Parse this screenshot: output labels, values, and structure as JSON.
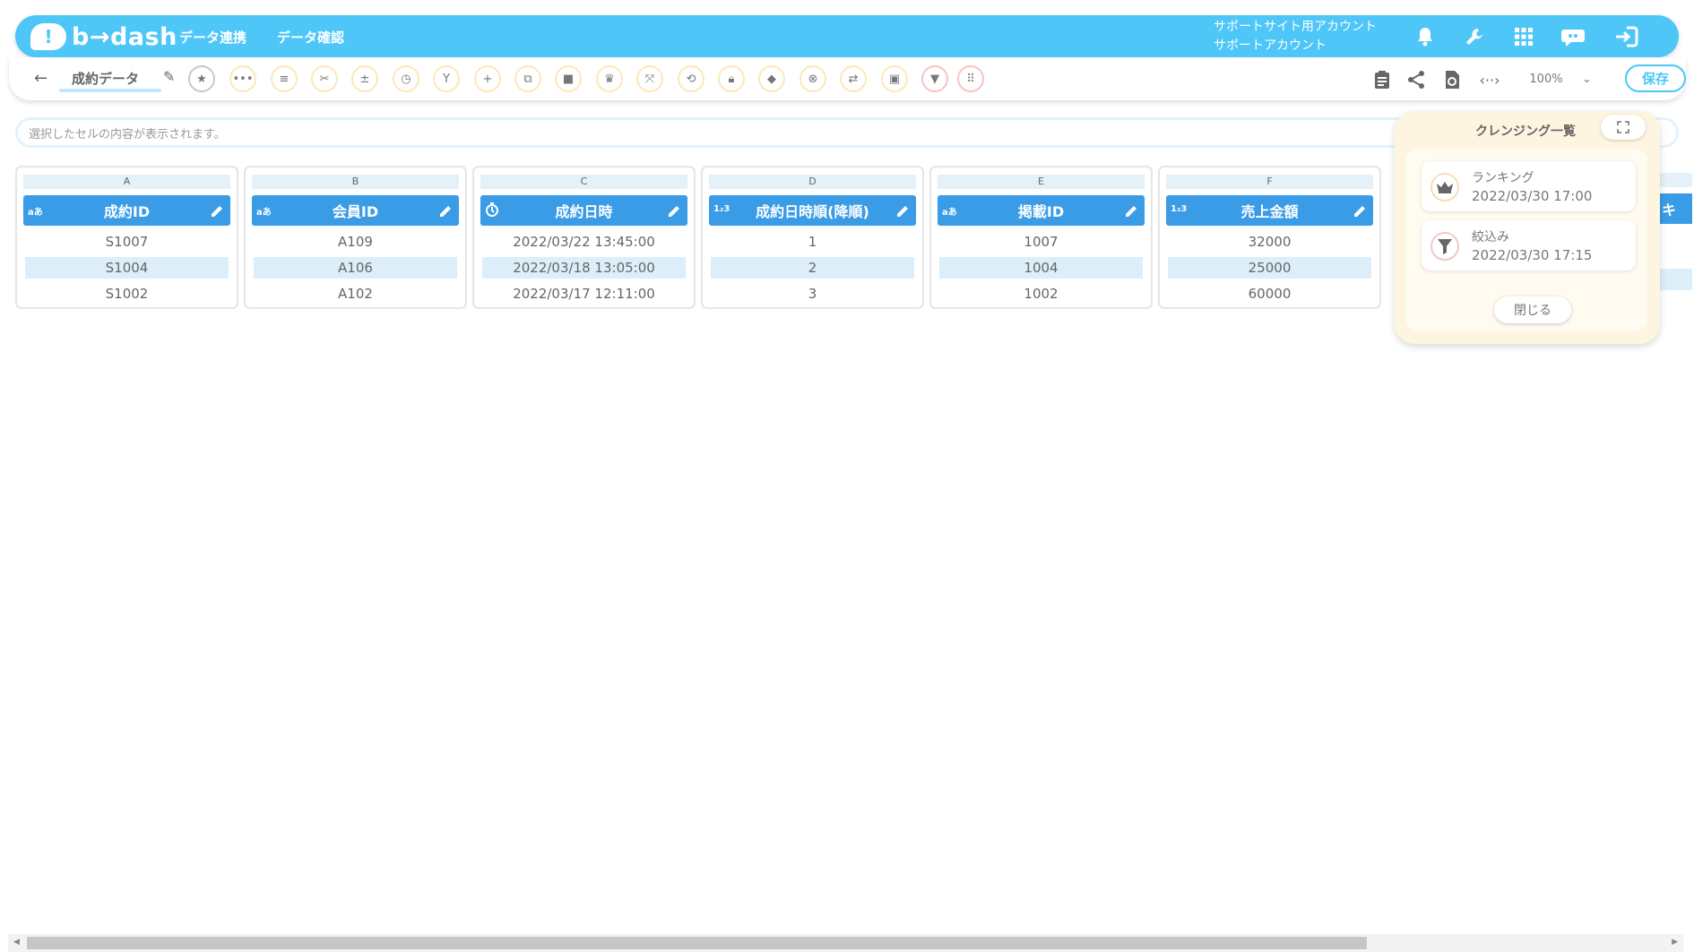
{
  "header": {
    "logo_text": "b→dash",
    "nav": [
      "データ連携",
      "データ確認"
    ],
    "account_line1": "サポートサイト用アカウント",
    "account_line2": "サポートアカウント"
  },
  "toolbar": {
    "sheet_name": "成約データ",
    "zoom": "100%",
    "save_label": "保存"
  },
  "cell_bar": {
    "placeholder": "選択したセルの内容が表示されます。"
  },
  "columns": [
    {
      "letter": "A",
      "type": "aあ",
      "name": "成約ID",
      "cells": [
        "S1007",
        "S1004",
        "S1002"
      ]
    },
    {
      "letter": "B",
      "type": "aあ",
      "name": "会員ID",
      "cells": [
        "A109",
        "A106",
        "A102"
      ]
    },
    {
      "letter": "C",
      "type": "clock",
      "name": "成約日時",
      "cells": [
        "2022/03/22 13:45:00",
        "2022/03/18 13:05:00",
        "2022/03/17 12:11:00"
      ]
    },
    {
      "letter": "D",
      "type": "1₂3",
      "name": "成約日時順(降順)",
      "cells": [
        "1",
        "2",
        "3"
      ]
    },
    {
      "letter": "E",
      "type": "aあ",
      "name": "掲載ID",
      "cells": [
        "1007",
        "1004",
        "1002"
      ]
    },
    {
      "letter": "F",
      "type": "1₂3",
      "name": "売上金額",
      "cells": [
        "32000",
        "25000",
        "60000"
      ]
    }
  ],
  "partial_column_head": "キ",
  "panel": {
    "title": "クレンジング一覧",
    "items": [
      {
        "name": "ランキング",
        "date": "2022/03/30 17:00",
        "icon": "crown-icon"
      },
      {
        "name": "絞込み",
        "date": "2022/03/30 17:15",
        "icon": "filter-icon"
      }
    ],
    "close_label": "閉じる"
  },
  "colors": {
    "brand": "#4ec6f8",
    "column_header": "#3a9be6",
    "panel_bg": "#fdf5df"
  }
}
